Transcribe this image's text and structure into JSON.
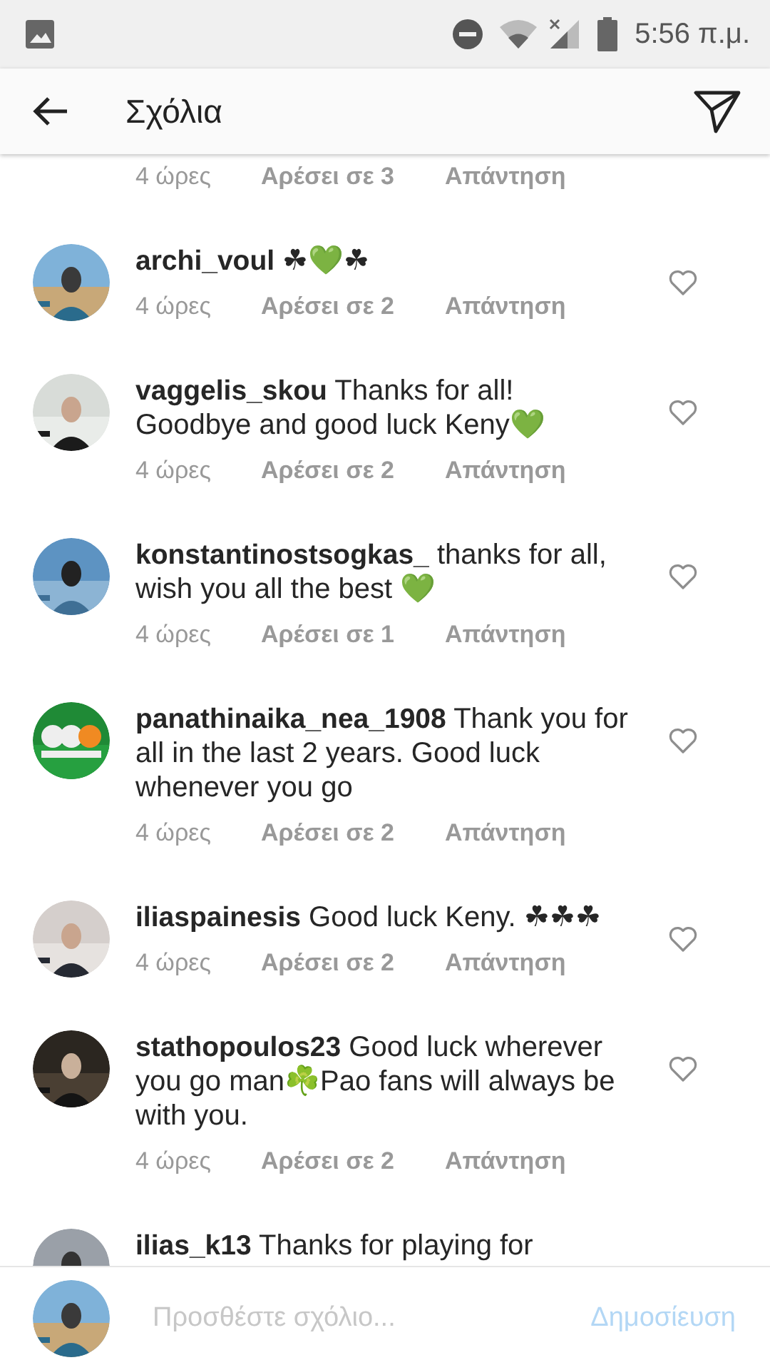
{
  "status_bar": {
    "time": "5:56 π.μ."
  },
  "header": {
    "title": "Σχόλια"
  },
  "comments": [
    {
      "kind": "partial_top",
      "time": "4 ώρες",
      "likes": "Αρέσει σε 3",
      "reply": "Απάντηση"
    },
    {
      "kind": "full",
      "text": "**archi_voul** ☘💚☘",
      "time": "4 ώρες",
      "likes": "Αρέσει σε 2",
      "reply": "Απάντηση"
    },
    {
      "kind": "full",
      "text": "**vaggelis_skou** Thanks for all! Goodbye and good luck Keny💚",
      "time": "4 ώρες",
      "likes": "Αρέσει σε 2",
      "reply": "Απάντηση"
    },
    {
      "kind": "full",
      "text": "**konstantinostsogkas_** thanks for all, wish you all the best 💚",
      "time": "4 ώρες",
      "likes": "Αρέσει σε 1",
      "reply": "Απάντηση"
    },
    {
      "kind": "full",
      "text": "**panathinaika_nea_1908** Thank you for all in the last 2 years. Good luck whenever you go",
      "time": "4 ώρες",
      "likes": "Αρέσει σε 2",
      "reply": "Απάντηση"
    },
    {
      "kind": "full",
      "text": "**iliaspainesis** Good luck Keny. ☘☘☘",
      "time": "4 ώρες",
      "likes": "Αρέσει σε 2",
      "reply": "Απάντηση"
    },
    {
      "kind": "full",
      "text": "**stathopoulos23** Good luck wherever you go man☘️Pao fans will always be with you.",
      "time": "4 ώρες",
      "likes": "Αρέσει σε 2",
      "reply": "Απάντηση"
    },
    {
      "kind": "partial_bottom",
      "text": "**ilias_k13** Thanks for playing for"
    }
  ],
  "composer": {
    "placeholder": "Προσθέστε σχόλιο...",
    "post": "Δημοσίευση"
  }
}
